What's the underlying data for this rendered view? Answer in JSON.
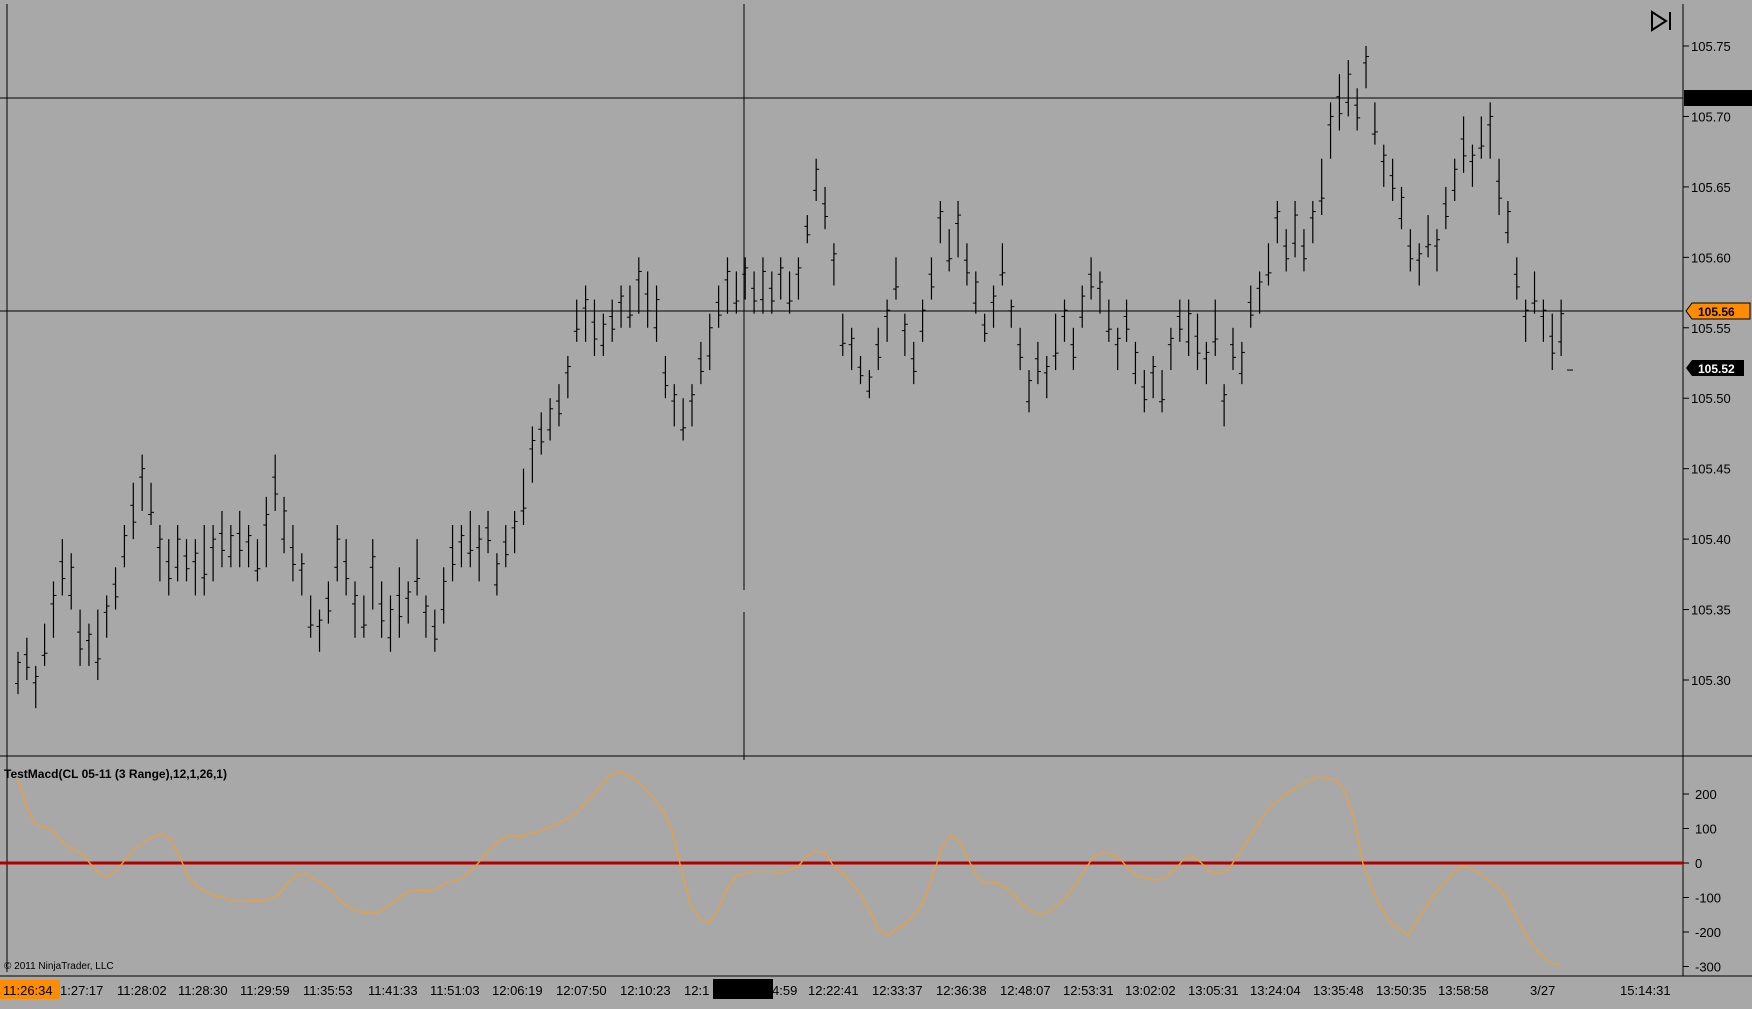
{
  "window": {
    "copyright": "© 2011 NinjaTrader, LLC"
  },
  "colors": {
    "background": "#a8a8a8",
    "bar": "#000000",
    "macd_line": "#e8a040",
    "zero_line": "#b00000",
    "current_tag_bg": "#000000",
    "current_tag_fg": "#ffffff",
    "cursor_tag_bg": "#ff8c00",
    "cursor_tag_fg": "#000000"
  },
  "icons": {
    "scroll_end": "scroll-to-end-icon"
  },
  "price_panel": {
    "current_price_label": "105.52",
    "cursor_price_label": "105.56",
    "cursor_price": 105.56,
    "current_price": 105.52,
    "top_marker_price": 105.71
  },
  "macd_panel": {
    "title": "TestMacd(CL 05-11 (3 Range),12,1,26,1)"
  },
  "time_axis": {
    "cursor_time_label": "11:26:34",
    "labels": [
      "1:27:17",
      "11:28:02",
      "11:28:30",
      "11:29:59",
      "11:35:53",
      "11:41:33",
      "11:51:03",
      "12:06:19",
      "12:07:50",
      "12:10:23",
      "12:1",
      "4:59",
      "12:22:41",
      "12:33:37",
      "12:36:38",
      "12:48:07",
      "12:53:31",
      "13:02:02",
      "13:05:31",
      "13:24:04",
      "13:35:48",
      "13:50:35",
      "13:58:58",
      "3/27",
      "15:14:31"
    ]
  },
  "chart_data": [
    {
      "type": "ohlc",
      "title": "",
      "ylim": [
        105.25,
        105.78
      ],
      "yticks": [
        "105.30",
        "105.35",
        "105.40",
        "105.45",
        "105.50",
        "105.55",
        "105.60",
        "105.65",
        "105.70",
        "105.75"
      ],
      "bars": [
        [
          105.32,
          105.29
        ],
        [
          105.33,
          105.3
        ],
        [
          105.31,
          105.28
        ],
        [
          105.34,
          105.31
        ],
        [
          105.37,
          105.33
        ],
        [
          105.4,
          105.36
        ],
        [
          105.39,
          105.35
        ],
        [
          105.35,
          105.31
        ],
        [
          105.34,
          105.31
        ],
        [
          105.35,
          105.3
        ],
        [
          105.36,
          105.33
        ],
        [
          105.38,
          105.35
        ],
        [
          105.41,
          105.38
        ],
        [
          105.44,
          105.4
        ],
        [
          105.46,
          105.42
        ],
        [
          105.44,
          105.41
        ],
        [
          105.41,
          105.37
        ],
        [
          105.4,
          105.36
        ],
        [
          105.41,
          105.37
        ],
        [
          105.4,
          105.37
        ],
        [
          105.4,
          105.36
        ],
        [
          105.41,
          105.36
        ],
        [
          105.41,
          105.37
        ],
        [
          105.42,
          105.38
        ],
        [
          105.41,
          105.38
        ],
        [
          105.42,
          105.38
        ],
        [
          105.41,
          105.38
        ],
        [
          105.4,
          105.37
        ],
        [
          105.43,
          105.38
        ],
        [
          105.46,
          105.42
        ],
        [
          105.43,
          105.39
        ],
        [
          105.41,
          105.37
        ],
        [
          105.39,
          105.36
        ],
        [
          105.36,
          105.33
        ],
        [
          105.35,
          105.32
        ],
        [
          105.37,
          105.34
        ],
        [
          105.41,
          105.37
        ],
        [
          105.4,
          105.36
        ],
        [
          105.37,
          105.33
        ],
        [
          105.36,
          105.33
        ],
        [
          105.4,
          105.35
        ],
        [
          105.37,
          105.33
        ],
        [
          105.36,
          105.32
        ],
        [
          105.38,
          105.33
        ],
        [
          105.37,
          105.34
        ],
        [
          105.4,
          105.36
        ],
        [
          105.36,
          105.33
        ],
        [
          105.35,
          105.32
        ],
        [
          105.38,
          105.34
        ],
        [
          105.41,
          105.37
        ],
        [
          105.41,
          105.38
        ],
        [
          105.42,
          105.38
        ],
        [
          105.41,
          105.37
        ],
        [
          105.42,
          105.39
        ],
        [
          105.39,
          105.36
        ],
        [
          105.41,
          105.38
        ],
        [
          105.42,
          105.39
        ],
        [
          105.45,
          105.41
        ],
        [
          105.48,
          105.44
        ],
        [
          105.49,
          105.46
        ],
        [
          105.5,
          105.47
        ],
        [
          105.51,
          105.48
        ],
        [
          105.53,
          105.5
        ],
        [
          105.57,
          105.54
        ],
        [
          105.58,
          105.54
        ],
        [
          105.57,
          105.53
        ],
        [
          105.56,
          105.53
        ],
        [
          105.57,
          105.54
        ],
        [
          105.58,
          105.55
        ],
        [
          105.58,
          105.55
        ],
        [
          105.6,
          105.56
        ],
        [
          105.59,
          105.55
        ],
        [
          105.58,
          105.54
        ],
        [
          105.53,
          105.5
        ],
        [
          105.51,
          105.48
        ],
        [
          105.5,
          105.47
        ],
        [
          105.51,
          105.48
        ],
        [
          105.54,
          105.51
        ],
        [
          105.56,
          105.52
        ],
        [
          105.58,
          105.55
        ],
        [
          105.6,
          105.56
        ],
        [
          105.59,
          105.56
        ],
        [
          105.6,
          105.57
        ],
        [
          105.59,
          105.56
        ],
        [
          105.6,
          105.56
        ],
        [
          105.59,
          105.56
        ],
        [
          105.6,
          105.57
        ],
        [
          105.59,
          105.56
        ],
        [
          105.6,
          105.57
        ],
        [
          105.63,
          105.61
        ],
        [
          105.67,
          105.64
        ],
        [
          105.65,
          105.62
        ],
        [
          105.61,
          105.58
        ],
        [
          105.56,
          105.53
        ],
        [
          105.55,
          105.52
        ],
        [
          105.53,
          105.51
        ],
        [
          105.52,
          105.5
        ],
        [
          105.55,
          105.52
        ],
        [
          105.57,
          105.54
        ],
        [
          105.6,
          105.57
        ],
        [
          105.56,
          105.53
        ],
        [
          105.54,
          105.51
        ],
        [
          105.57,
          105.54
        ],
        [
          105.6,
          105.57
        ],
        [
          105.64,
          105.61
        ],
        [
          105.62,
          105.59
        ],
        [
          105.64,
          105.6
        ],
        [
          105.61,
          105.58
        ],
        [
          105.59,
          105.56
        ],
        [
          105.56,
          105.54
        ],
        [
          105.58,
          105.55
        ],
        [
          105.61,
          105.58
        ],
        [
          105.57,
          105.55
        ],
        [
          105.55,
          105.52
        ],
        [
          105.52,
          105.49
        ],
        [
          105.54,
          105.51
        ],
        [
          105.53,
          105.5
        ],
        [
          105.56,
          105.52
        ],
        [
          105.57,
          105.54
        ],
        [
          105.55,
          105.52
        ],
        [
          105.58,
          105.55
        ],
        [
          105.6,
          105.57
        ],
        [
          105.59,
          105.56
        ],
        [
          105.57,
          105.54
        ],
        [
          105.55,
          105.52
        ],
        [
          105.57,
          105.54
        ],
        [
          105.54,
          105.51
        ],
        [
          105.52,
          105.49
        ],
        [
          105.53,
          105.5
        ],
        [
          105.52,
          105.49
        ],
        [
          105.55,
          105.52
        ],
        [
          105.57,
          105.54
        ],
        [
          105.57,
          105.53
        ],
        [
          105.56,
          105.52
        ],
        [
          105.54,
          105.51
        ],
        [
          105.57,
          105.53
        ],
        [
          105.51,
          105.48
        ],
        [
          105.55,
          105.52
        ],
        [
          105.54,
          105.51
        ],
        [
          105.58,
          105.55
        ],
        [
          105.59,
          105.56
        ],
        [
          105.61,
          105.58
        ],
        [
          105.64,
          105.61
        ],
        [
          105.62,
          105.59
        ],
        [
          105.64,
          105.6
        ],
        [
          105.62,
          105.59
        ],
        [
          105.64,
          105.61
        ],
        [
          105.67,
          105.63
        ],
        [
          105.71,
          105.67
        ],
        [
          105.73,
          105.69
        ],
        [
          105.74,
          105.7
        ],
        [
          105.72,
          105.69
        ],
        [
          105.75,
          105.72
        ],
        [
          105.71,
          105.68
        ],
        [
          105.68,
          105.65
        ],
        [
          105.67,
          105.64
        ],
        [
          105.65,
          105.62
        ],
        [
          105.62,
          105.59
        ],
        [
          105.61,
          105.58
        ],
        [
          105.63,
          105.6
        ],
        [
          105.62,
          105.59
        ],
        [
          105.65,
          105.62
        ],
        [
          105.67,
          105.64
        ],
        [
          105.7,
          105.66
        ],
        [
          105.68,
          105.65
        ],
        [
          105.7,
          105.67
        ],
        [
          105.71,
          105.67
        ],
        [
          105.67,
          105.63
        ],
        [
          105.64,
          105.61
        ],
        [
          105.6,
          105.57
        ],
        [
          105.57,
          105.54
        ],
        [
          105.59,
          105.56
        ],
        [
          105.57,
          105.54
        ],
        [
          105.56,
          105.52
        ],
        [
          105.57,
          105.53
        ],
        [
          105.52,
          105.52
        ]
      ]
    },
    {
      "type": "line",
      "title": "TestMacd(CL 05-11 (3 Range),12,1,26,1)",
      "ylim": [
        -320,
        260
      ],
      "yticks": [
        "200",
        "100",
        "0",
        "-100",
        "-200",
        "-300"
      ],
      "zero_line": 0,
      "series": [
        {
          "values": [
            245,
            160,
            110,
            105,
            90,
            60,
            40,
            30,
            0,
            -30,
            -40,
            -20,
            10,
            40,
            60,
            75,
            85,
            70,
            20,
            -40,
            -70,
            -85,
            -95,
            -100,
            -110,
            -112,
            -108,
            -110,
            -105,
            -95,
            -60,
            -35,
            -30,
            -45,
            -60,
            -80,
            -110,
            -130,
            -140,
            -145,
            -145,
            -130,
            -110,
            -90,
            -78,
            -80,
            -80,
            -70,
            -55,
            -50,
            -35,
            -10,
            20,
            50,
            70,
            80,
            75,
            85,
            90,
            100,
            110,
            125,
            140,
            165,
            195,
            225,
            255,
            265,
            255,
            240,
            215,
            185,
            150,
            90,
            -20,
            -120,
            -160,
            -175,
            -140,
            -80,
            -40,
            -30,
            -25,
            -25,
            -25,
            -30,
            -20,
            -10,
            20,
            35,
            30,
            -10,
            -30,
            -60,
            -90,
            -140,
            -190,
            -210,
            -190,
            -175,
            -150,
            -110,
            -40,
            40,
            80,
            65,
            10,
            -40,
            -60,
            -55,
            -70,
            -90,
            -120,
            -140,
            -150,
            -140,
            -120,
            -95,
            -60,
            -20,
            20,
            30,
            25,
            10,
            -20,
            -40,
            -45,
            -50,
            -40,
            -20,
            10,
            20,
            0,
            -25,
            -30,
            -20,
            20,
            60,
            100,
            140,
            170,
            190,
            210,
            225,
            240,
            250,
            245,
            240,
            210,
            130,
            0,
            -70,
            -130,
            -170,
            -190,
            -210,
            -170,
            -130,
            -90,
            -60,
            -30,
            -10,
            -15,
            -30,
            -50,
            -70,
            -100,
            -150,
            -200,
            -240,
            -270,
            -290,
            -295
          ]
        }
      ]
    }
  ]
}
